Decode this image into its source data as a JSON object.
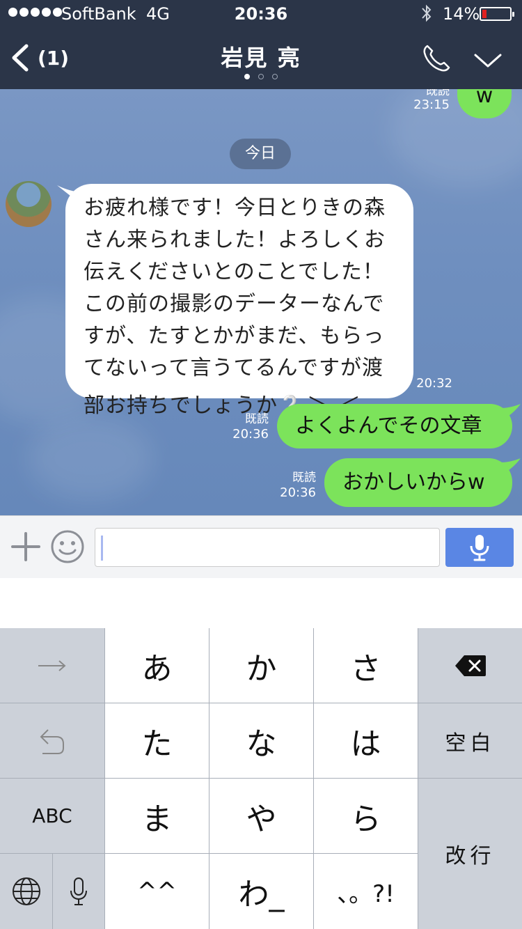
{
  "status_bar": {
    "carrier": "SoftBank",
    "network": "4G",
    "time": "20:36",
    "battery_percent": "14%",
    "battery_level": 0.14,
    "battery_color": "#e02020"
  },
  "nav": {
    "back_count": "(1)",
    "title": "岩見 亮",
    "page_dots": 3,
    "active_dot": 0
  },
  "chat": {
    "prev_message": {
      "text": "w",
      "read_label": "既読",
      "time": "23:15"
    },
    "date_divider": "今日",
    "incoming": {
      "lines": [
        "お疲れ様です！今日とりきの森",
        "さん来られました！よろしくお",
        "伝えくださいとのことでした！",
        "この前の撮影のデーターなんで",
        "すが、たすとかがまだ、もらっ",
        "てないって言うてるんですが渡",
        "部お持ちでしょうか",
        "❔",
        "＞_＜"
      ],
      "time": "20:32"
    },
    "outgoing": [
      {
        "text": "よくよんでその文章",
        "read_label": "既読",
        "time": "20:36"
      },
      {
        "text": "おかしいからw",
        "read_label": "既読",
        "time": "20:36"
      }
    ]
  },
  "input": {
    "value": "",
    "plus_icon": "plus-icon",
    "emoji_icon": "smiley-icon",
    "mic_icon": "microphone-icon",
    "accent": "#5a86e4"
  },
  "keyboard": {
    "row1": [
      "→",
      "あ",
      "か",
      "さ",
      "⌫"
    ],
    "row2": [
      "↩",
      "た",
      "な",
      "は",
      "空白"
    ],
    "row3": [
      "ABC",
      "ま",
      "や",
      "ら",
      "改行"
    ],
    "row4": [
      "🌐",
      "🎤",
      "^^",
      "わ_",
      "、。?!"
    ]
  }
}
